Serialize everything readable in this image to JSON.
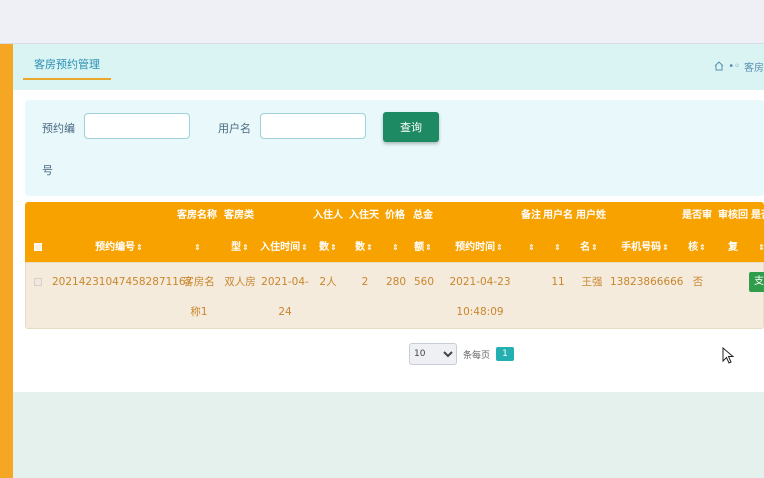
{
  "tab": {
    "label": "客房预约管理"
  },
  "breadcrumb": {
    "separator": "•◦",
    "label": "客房"
  },
  "search": {
    "booking_no_label_1": "预约编",
    "booking_no_label_2": "号",
    "booking_no_value": "",
    "username_label": "用户名",
    "username_value": "",
    "query_button": "查询"
  },
  "table": {
    "headers": {
      "booking_no": "预约编号",
      "room_name_1": "客房名称",
      "room_type_1": "客房类",
      "room_type_2": "型",
      "checkin_time": "入住时间",
      "guests_1": "入住人",
      "guests_2": "数",
      "days_1": "入住天",
      "days_2": "数",
      "price": "价格",
      "total_1": "总金",
      "total_2": "额",
      "booking_time": "预约时间",
      "remark": "备注",
      "username": "用户名",
      "surname_1": "用户姓",
      "surname_2": "名",
      "phone": "手机号码",
      "reviewed_1": "是否审",
      "reviewed_2": "核",
      "review_reply_1": "审核回",
      "review_reply_2": "复",
      "paid_1": "是否"
    },
    "rows": [
      {
        "booking_no": "20214231047458287116 7",
        "booking_no_display": "202142310474582871167",
        "room_name_1": "客房名",
        "room_name_2": "称1",
        "room_type": "双人房",
        "checkin_1": "2021-04-",
        "checkin_2": "24",
        "guests": "2人",
        "days": "2",
        "price": "280",
        "total": "560",
        "booking_time_1": "2021-04-23",
        "booking_time_2": "10:48:09",
        "username": "11",
        "surname": "王强",
        "phone": "13823866666",
        "reviewed": "否",
        "action": "支"
      }
    ]
  },
  "pager": {
    "page_size": "10",
    "page_size_label": "条每页",
    "current_page": "1"
  },
  "colors": {
    "accent_orange": "#f5a623",
    "header_orange": "#f8a200",
    "query_green": "#1e8a63",
    "pager_teal": "#24b0b0"
  }
}
